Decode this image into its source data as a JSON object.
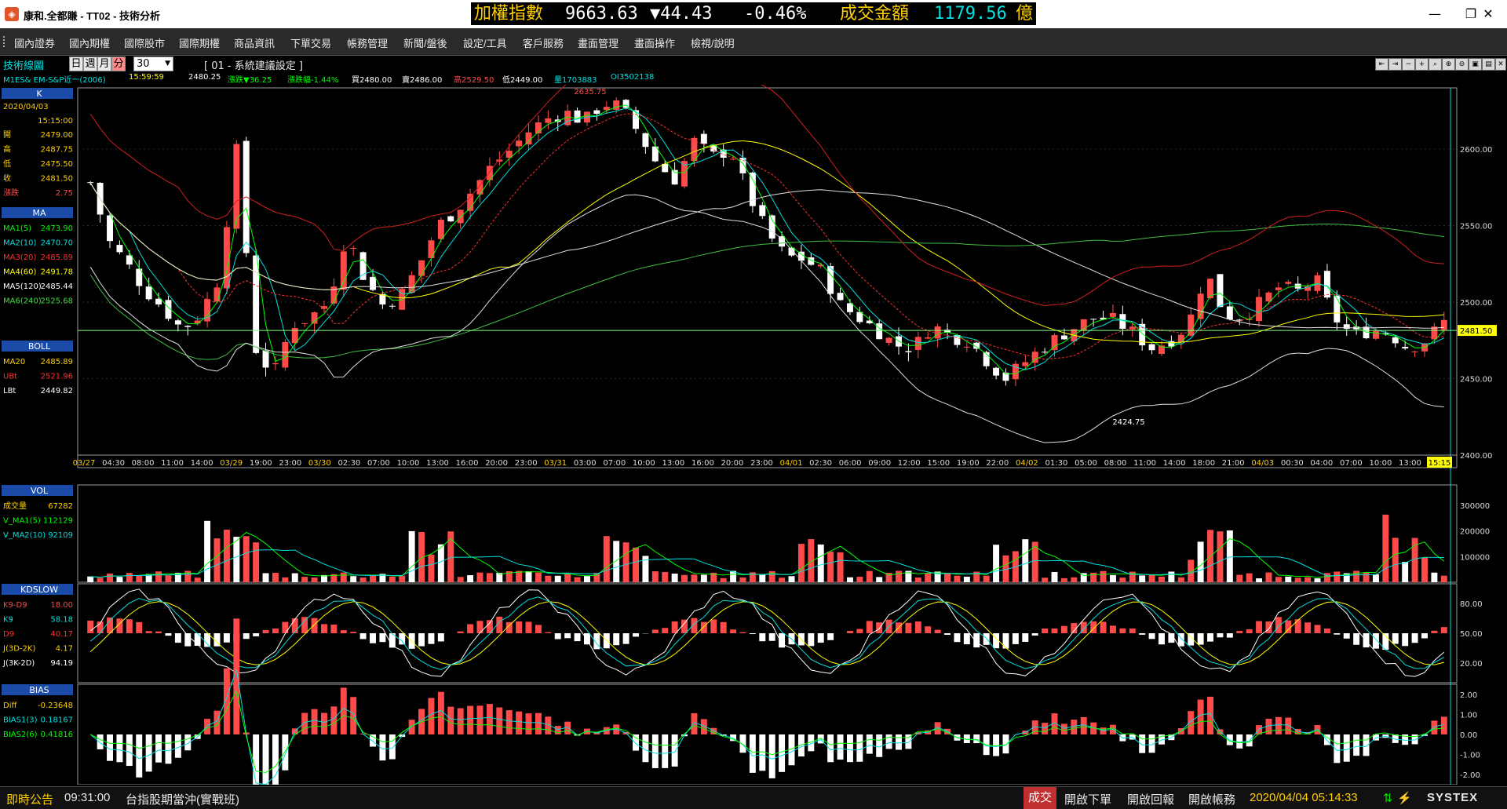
{
  "window": {
    "title": "康和.全都賺 - TT02 - 技術分析",
    "controls": [
      "—",
      "❐",
      "✕"
    ]
  },
  "ticker": {
    "index_label": "加權指數",
    "index_value": "9663.63",
    "change": "▼44.43",
    "change_pct": "-0.46%",
    "turnover_label": "成交金額",
    "turnover_value": "1179.56",
    "unit": "億"
  },
  "menu": [
    "國內證券",
    "國內期權",
    "國際股市",
    "國際期權",
    "商品資訊",
    "下單交易",
    "帳務管理",
    "新聞/盤後",
    "設定/工具",
    "客戶服務",
    "畫面管理",
    "畫面操作",
    "檢視/說明"
  ],
  "toolbar": {
    "title": "技術線圖",
    "periods": [
      "日",
      "週",
      "月",
      "分"
    ],
    "active_period": "分",
    "interval": "30",
    "setting_label": "[ 01 - 系統建議設定 ]",
    "icons": [
      "zoom-out-icon",
      "zoom-in-icon",
      "minus-icon",
      "plus-icon",
      "search-icon",
      "search-plus-icon",
      "search-minus-icon",
      "save-icon",
      "print-icon",
      "print-setup-icon",
      "close-window-icon"
    ]
  },
  "quote": {
    "symbol": "M1ES& EM-S&P近一(2006)",
    "time": "15:59:59",
    "price": "2480.25",
    "change": "漲跌▼36.25",
    "change_pct": "漲跌幅-1.44%",
    "bid": "買2480.00",
    "ask": "賣2486.00",
    "high": "高2529.50",
    "low": "低2449.00",
    "volume": "量1703883",
    "oi": "OI3502138"
  },
  "panels": {
    "k": {
      "header": "K",
      "date": "2020/04/03",
      "time": "15:15:00",
      "rows": [
        [
          "開",
          "2479.00"
        ],
        [
          "高",
          "2487.75"
        ],
        [
          "低",
          "2475.50"
        ],
        [
          "收",
          "2481.50"
        ],
        [
          "漲跌",
          "2.75"
        ]
      ]
    },
    "ma": {
      "header": "MA",
      "rows": [
        [
          "MA1(5)",
          "2473.90"
        ],
        [
          "MA2(10)",
          "2470.70"
        ],
        [
          "MA3(20)",
          "2485.89"
        ],
        [
          "MA4(60)",
          "2491.78"
        ],
        [
          "MA5(120)",
          "2485.44"
        ],
        [
          "MA6(240)",
          "2525.68"
        ]
      ]
    },
    "boll": {
      "header": "BOLL",
      "rows": [
        [
          "MA20",
          "2485.89"
        ],
        [
          "UBt",
          "2521.96"
        ],
        [
          "LBt",
          "2449.82"
        ]
      ]
    },
    "vol": {
      "header": "VOL",
      "rows": [
        [
          "成交量",
          "67282"
        ],
        [
          "V_MA1(5)",
          "112129"
        ],
        [
          "V_MA2(10)",
          "92109"
        ]
      ]
    },
    "kd": {
      "header": "KDSLOW",
      "rows": [
        [
          "K9-D9",
          "18.00"
        ],
        [
          "K9",
          "58.18"
        ],
        [
          "D9",
          "40.17"
        ],
        [
          "J(3D-2K)",
          "4.17"
        ],
        [
          "J(3K-2D)",
          "94.19"
        ]
      ]
    },
    "bias": {
      "header": "BIAS",
      "rows": [
        [
          "Diff",
          "-0.23648"
        ],
        [
          "BIAS1(3)",
          "0.18167"
        ],
        [
          "BIAS2(6)",
          "0.41816"
        ]
      ]
    }
  },
  "chart_data": {
    "type": "candlestick",
    "instrument": "M1ES& EM-S&P近一(2006)",
    "interval": "30",
    "price_axis": {
      "ticks": [
        "2600.00",
        "2550.00",
        "2500.00",
        "2450.00",
        "2400.00"
      ],
      "range": [
        2400,
        2640
      ]
    },
    "time_axis": [
      "03/27",
      "04:30",
      "08:00",
      "11:00",
      "14:00",
      "03/29",
      "19:00",
      "23:00",
      "03/30",
      "02:30",
      "07:00",
      "10:00",
      "13:00",
      "16:00",
      "20:00",
      "23:00",
      "03/31",
      "03:00",
      "07:00",
      "10:00",
      "13:00",
      "16:00",
      "20:00",
      "23:00",
      "04/01",
      "02:30",
      "06:00",
      "09:00",
      "12:00",
      "15:00",
      "19:00",
      "22:00",
      "04/02",
      "01:30",
      "05:00",
      "08:00",
      "11:00",
      "14:00",
      "18:00",
      "21:00",
      "04/03",
      "00:30",
      "04:00",
      "07:00",
      "10:00",
      "13:00",
      "15:15"
    ],
    "last_price_label": "2481.50",
    "high_label": "2635.75",
    "low_label": "2424.75",
    "close_path": [
      2578,
      2540,
      2525,
      2508,
      2496,
      2482,
      2492,
      2515,
      2600,
      2470,
      2452,
      2485,
      2490,
      2500,
      2545,
      2515,
      2498,
      2505,
      2525,
      2550,
      2560,
      2575,
      2590,
      2600,
      2612,
      2620,
      2624,
      2618,
      2630,
      2628,
      2610,
      2590,
      2580,
      2605,
      2595,
      2600,
      2570,
      2545,
      2530,
      2528,
      2520,
      2498,
      2490,
      2482,
      2472,
      2470,
      2485,
      2478,
      2475,
      2462,
      2450,
      2460,
      2470,
      2478,
      2485,
      2490,
      2488,
      2480,
      2470,
      2475,
      2485,
      2520,
      2492,
      2490,
      2500,
      2510,
      2507,
      2515,
      2490,
      2478,
      2482,
      2480,
      2470,
      2475,
      2487
    ],
    "volume_axis": {
      "ticks": [
        "300000",
        "200000",
        "100000"
      ],
      "range": [
        0,
        380000
      ]
    },
    "kd_axis": {
      "ticks": [
        "80.00",
        "50.00",
        "20.00"
      ],
      "range": [
        0,
        100
      ]
    },
    "bias_axis": {
      "ticks": [
        "2.00",
        "1.00",
        "0.00",
        "-1.00",
        "-2.00"
      ],
      "range": [
        -2.5,
        2.5
      ]
    },
    "colors": {
      "up": "#ff4a4a",
      "down": "#ffffff",
      "ma5": "#00ff00",
      "ma10": "#00e0e0",
      "ma20": "#ff3030",
      "ma60": "#ffff00",
      "ma120": "#e0e0e0",
      "ma240": "#40c040",
      "boll_ub": "#d02020",
      "boll_lb": "#e0e0e0",
      "kd_k": "#ffffff",
      "kd_d": "#ffff00",
      "kd_j": "#00e0e0",
      "bias1": "#00e0e0",
      "bias2": "#00ff00"
    }
  },
  "status": {
    "bulletin_label": "即時公告",
    "bulletin_time": "09:31:00",
    "bulletin_text": "台指股期當沖(實戰班)",
    "deal": "成交",
    "open_order": "開啟下單",
    "open_report": "開啟回報",
    "open_account": "開啟帳務",
    "datetime": "2020/04/04 05:14:33",
    "brand": "SYSTEX"
  }
}
